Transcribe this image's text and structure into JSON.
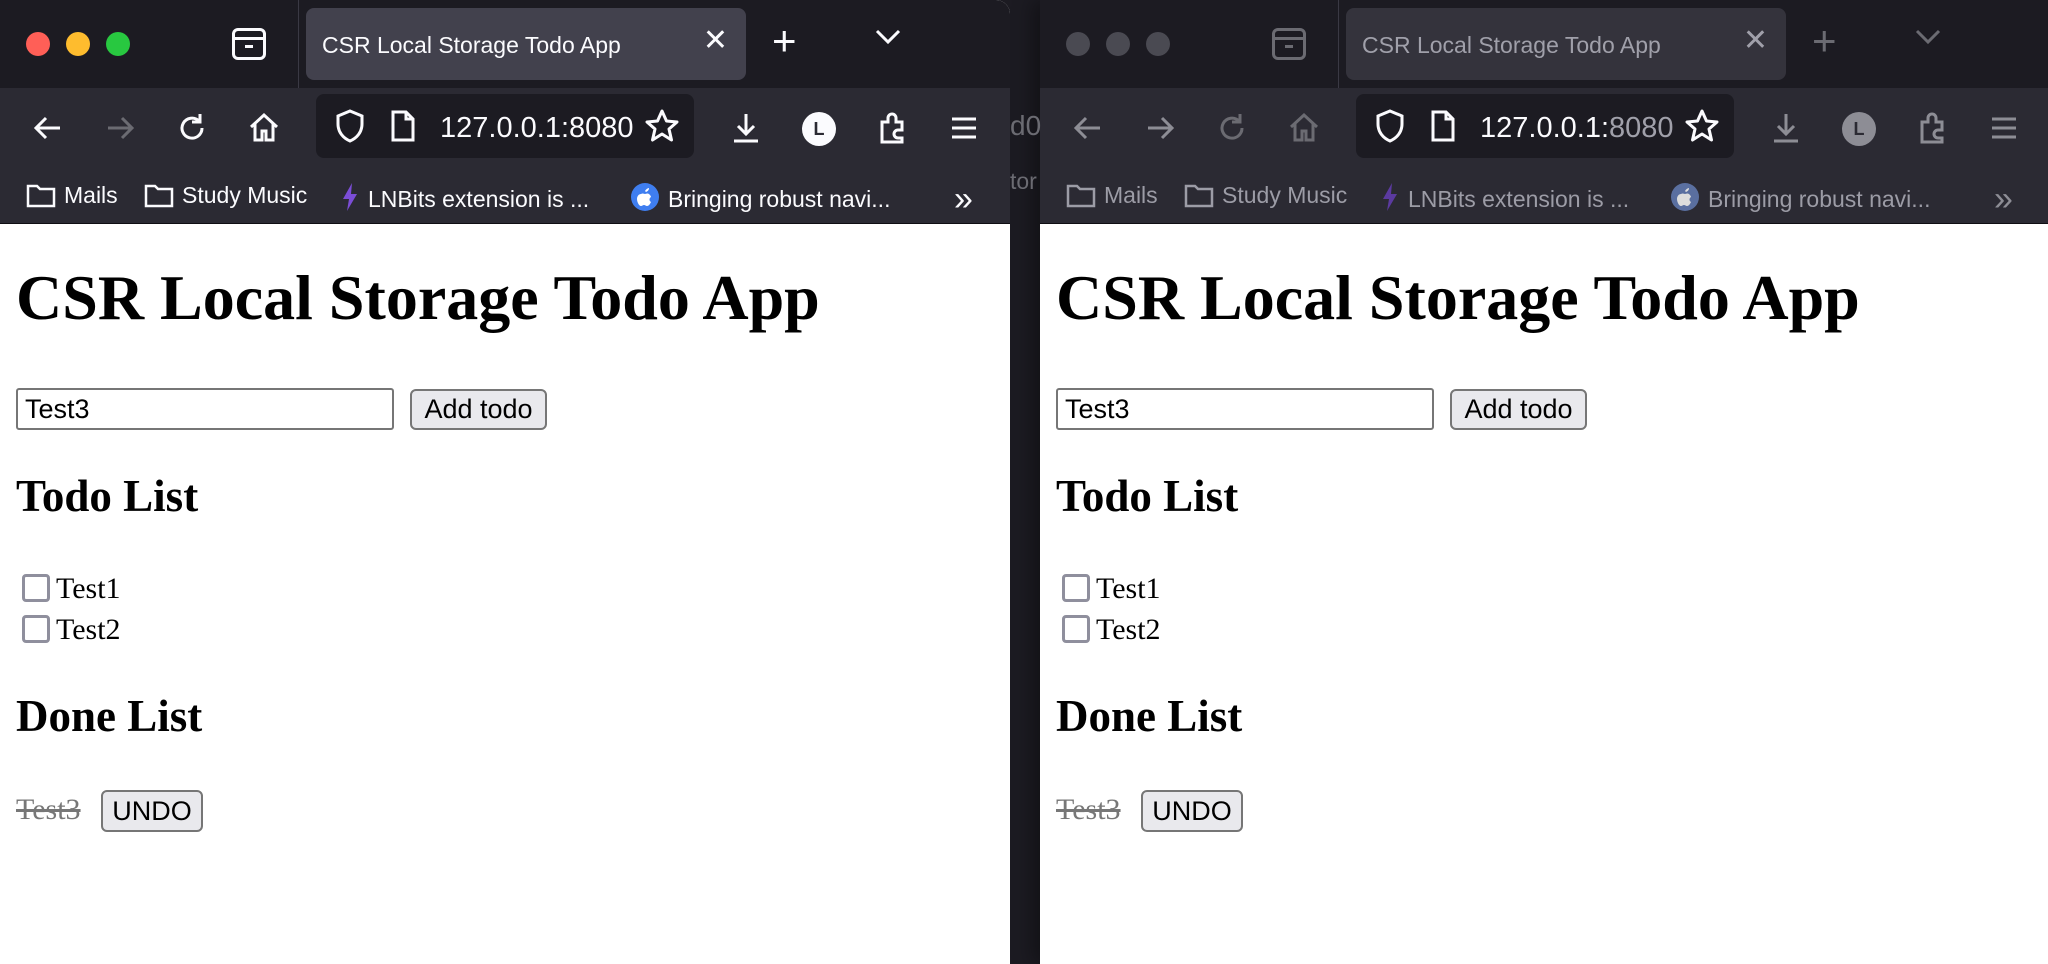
{
  "browser": {
    "tab_title": "CSR Local Storage Todo App",
    "url": "127.0.0.1:8080",
    "url_host": "127.0.0.1:",
    "url_port": "8080",
    "overflow_url_fragment": "d0",
    "overflow_url_fragment_2": "tor",
    "account_initial": "L",
    "bookmarks": [
      {
        "label": "Mails",
        "icon": "folder-icon"
      },
      {
        "label": "Study Music",
        "icon": "folder-icon"
      },
      {
        "label": "LNBits extension is ...",
        "icon": "lightning-icon"
      },
      {
        "label": "Bringing robust navi...",
        "icon": "apple-icon"
      }
    ]
  },
  "app": {
    "title": "CSR Local Storage Todo App",
    "input_value": "Test3",
    "add_button": "Add todo",
    "todo_heading": "Todo List",
    "todos": [
      "Test1",
      "Test2"
    ],
    "done_heading": "Done List",
    "done": [
      {
        "label": "Test3",
        "undo": "UNDO"
      }
    ]
  },
  "colors": {
    "chrome_dark": "#1c1b22",
    "toolbar": "#2b2a33",
    "active_tab": "#42414d",
    "close_red": "#ff5f57",
    "minimize_yellow": "#febc2e",
    "maximize_green": "#28c840",
    "lnbits_purple": "#7b4dd6",
    "apple_blue": "#3f7ef0"
  }
}
